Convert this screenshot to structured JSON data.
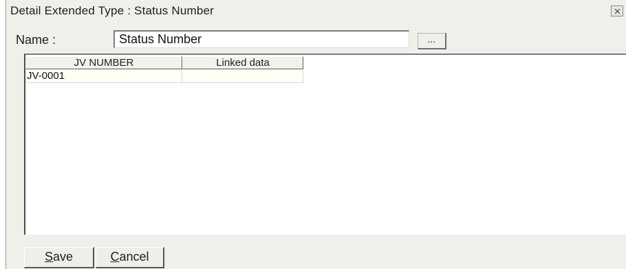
{
  "window": {
    "title": "Detail Extended Type : Status Number"
  },
  "form": {
    "name_label": "Name :",
    "name_value": "Status Number",
    "browse_label": "..."
  },
  "grid": {
    "columns": [
      "JV NUMBER",
      "Linked data"
    ],
    "rows": [
      [
        "JV-0001",
        ""
      ]
    ]
  },
  "footer": {
    "save_mnemonic": "S",
    "save_rest": "ave",
    "cancel_mnemonic": "C",
    "cancel_rest": "ancel"
  },
  "icons": {
    "close": "close-icon"
  }
}
